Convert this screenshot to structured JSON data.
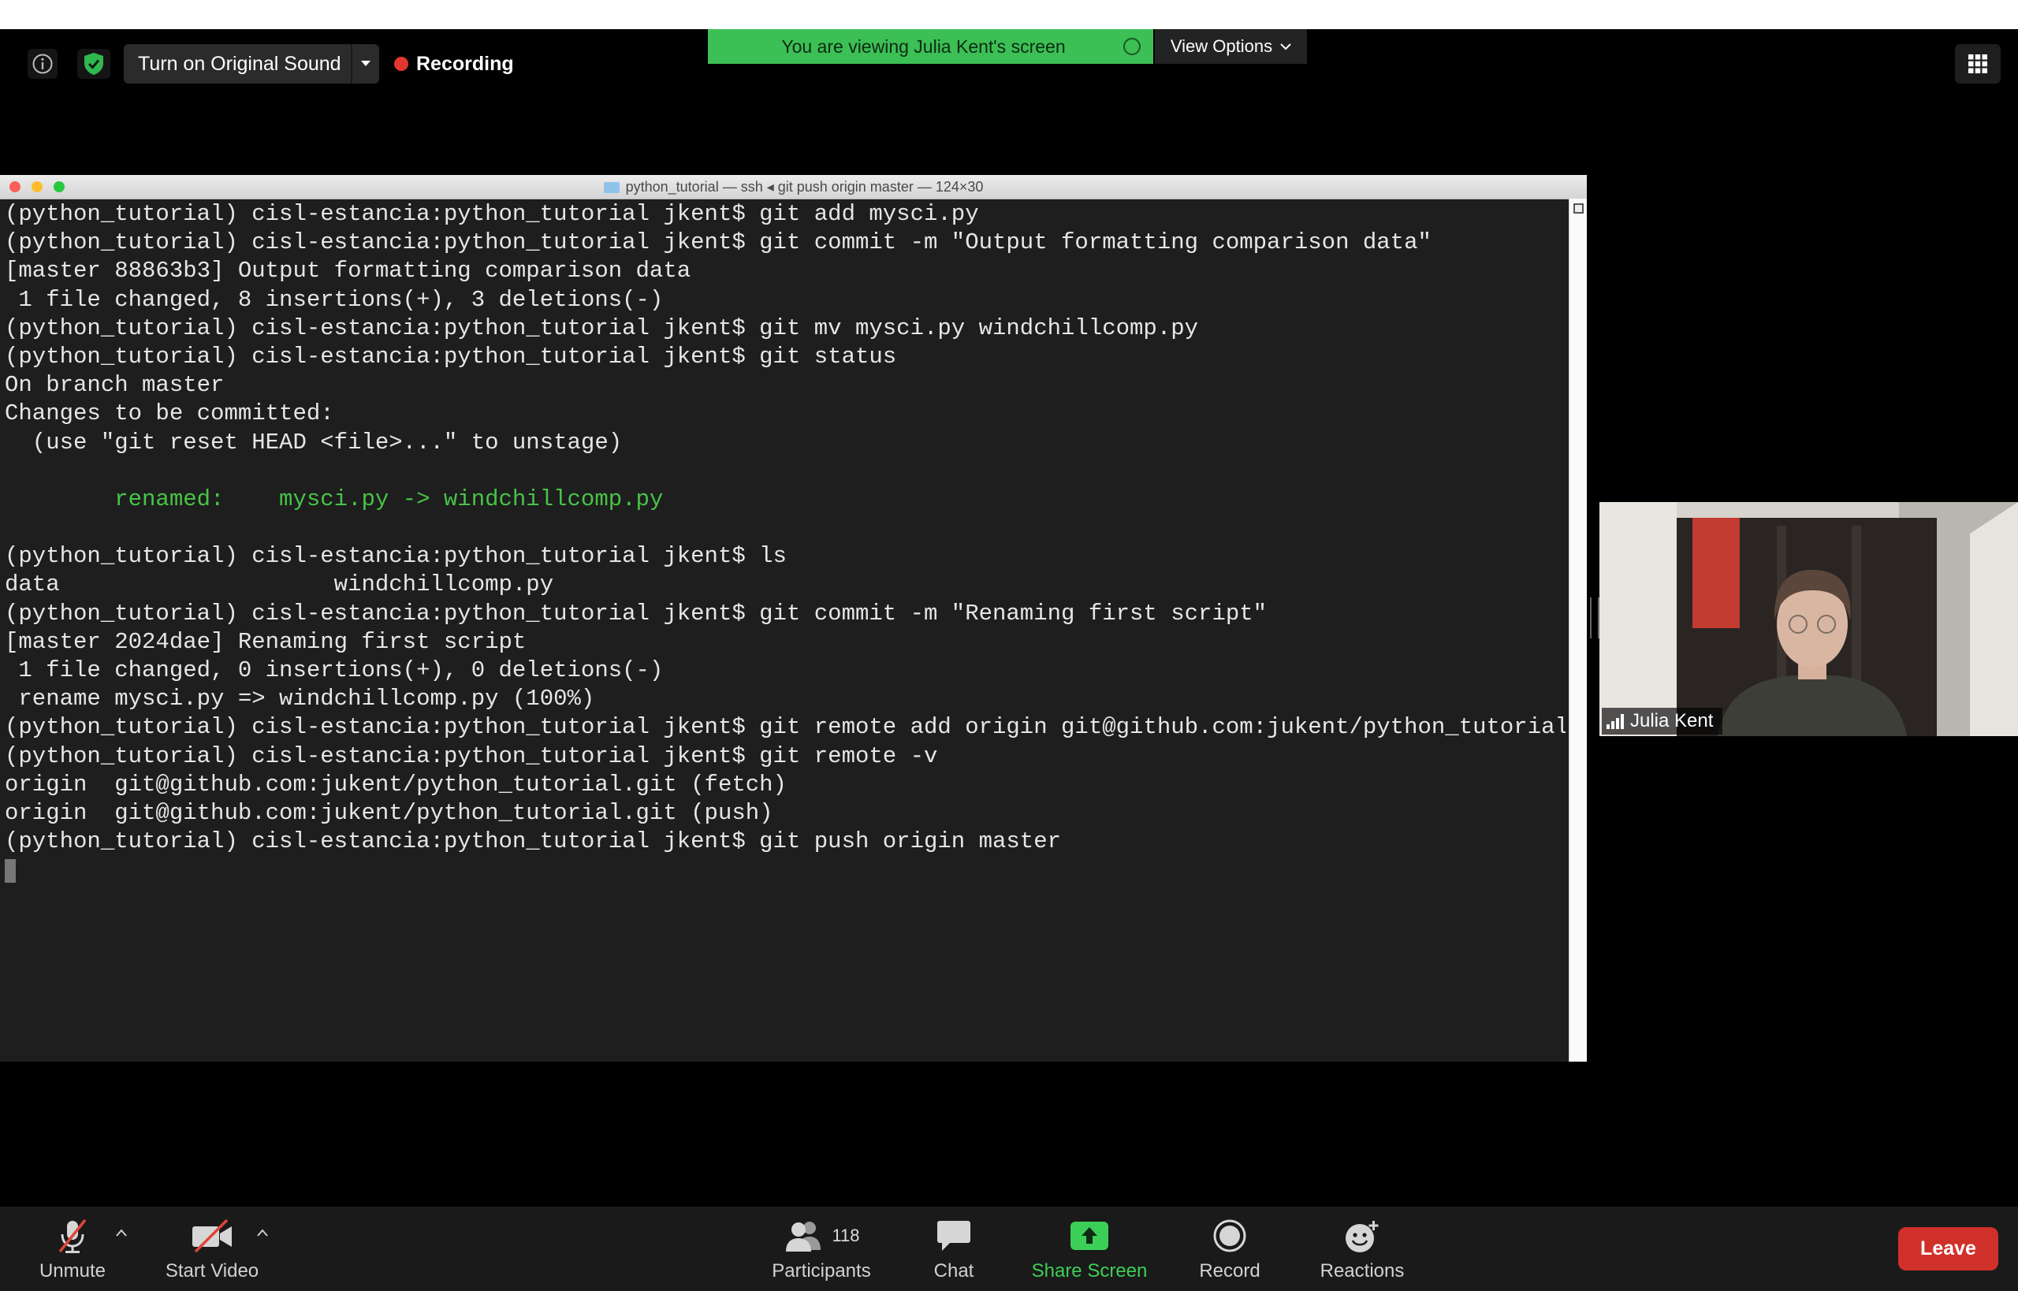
{
  "top_bar": {
    "info_icon": "info-icon",
    "security_icon": "shield-check-icon",
    "original_sound_label": "Turn on Original Sound",
    "recording_label": "Recording",
    "viewing_banner": "You are viewing Julia Kent's screen",
    "view_options_label": "View Options",
    "gallery_icon": "grid-icon"
  },
  "terminal": {
    "title": "python_tutorial — ssh ◂ git push origin master — 124×30",
    "lines": [
      {
        "text": "(python_tutorial) cisl-estancia:python_tutorial jkent$ git add mysci.py",
        "color": "#e6e6e6"
      },
      {
        "text": "(python_tutorial) cisl-estancia:python_tutorial jkent$ git commit -m \"Output formatting comparison data\"",
        "color": "#e6e6e6"
      },
      {
        "text": "[master 88863b3] Output formatting comparison data",
        "color": "#e6e6e6"
      },
      {
        "text": " 1 file changed, 8 insertions(+), 3 deletions(-)",
        "color": "#e6e6e6"
      },
      {
        "text": "(python_tutorial) cisl-estancia:python_tutorial jkent$ git mv mysci.py windchillcomp.py",
        "color": "#e6e6e6"
      },
      {
        "text": "(python_tutorial) cisl-estancia:python_tutorial jkent$ git status",
        "color": "#e6e6e6"
      },
      {
        "text": "On branch master",
        "color": "#e6e6e6"
      },
      {
        "text": "Changes to be committed:",
        "color": "#e6e6e6"
      },
      {
        "text": "  (use \"git reset HEAD <file>...\" to unstage)",
        "color": "#e6e6e6"
      },
      {
        "text": "",
        "color": "#e6e6e6"
      },
      {
        "text": "        renamed:    mysci.py -> windchillcomp.py",
        "color": "#47c447"
      },
      {
        "text": "",
        "color": "#e6e6e6"
      },
      {
        "text": "(python_tutorial) cisl-estancia:python_tutorial jkent$ ls",
        "color": "#e6e6e6"
      },
      {
        "text": "data                    windchillcomp.py",
        "color": "#e6e6e6"
      },
      {
        "text": "(python_tutorial) cisl-estancia:python_tutorial jkent$ git commit -m \"Renaming first script\"",
        "color": "#e6e6e6"
      },
      {
        "text": "[master 2024dae] Renaming first script",
        "color": "#e6e6e6"
      },
      {
        "text": " 1 file changed, 0 insertions(+), 0 deletions(-)",
        "color": "#e6e6e6"
      },
      {
        "text": " rename mysci.py => windchillcomp.py (100%)",
        "color": "#e6e6e6"
      },
      {
        "text": "(python_tutorial) cisl-estancia:python_tutorial jkent$ git remote add origin git@github.com:jukent/python_tutorial.git",
        "color": "#e6e6e6"
      },
      {
        "text": "(python_tutorial) cisl-estancia:python_tutorial jkent$ git remote -v",
        "color": "#e6e6e6"
      },
      {
        "text": "origin  git@github.com:jukent/python_tutorial.git (fetch)",
        "color": "#e6e6e6"
      },
      {
        "text": "origin  git@github.com:jukent/python_tutorial.git (push)",
        "color": "#e6e6e6"
      },
      {
        "text": "(python_tutorial) cisl-estancia:python_tutorial jkent$ git push origin master",
        "color": "#e6e6e6"
      }
    ]
  },
  "participant": {
    "name": "Julia Kent"
  },
  "toolbar": {
    "unmute_label": "Unmute",
    "start_video_label": "Start Video",
    "participants_label": "Participants",
    "participants_count": "118",
    "chat_label": "Chat",
    "share_screen_label": "Share Screen",
    "record_label": "Record",
    "reactions_label": "Reactions",
    "leave_label": "Leave"
  },
  "colors": {
    "banner_green": "#3cbf55",
    "share_green": "#3ccf57",
    "leave_red": "#d0302a",
    "recording_red": "#e2372f",
    "terminal_bg": "#1e1e1e",
    "terminal_green_text": "#47c447"
  }
}
